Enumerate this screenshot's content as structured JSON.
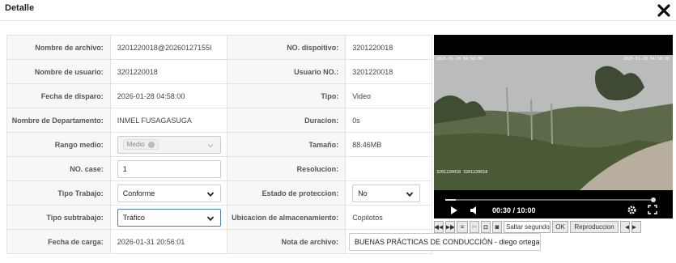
{
  "dialog": {
    "title": "Detalle"
  },
  "fields": {
    "file_name": {
      "label": "Nombre de archivo:",
      "value": "3201220018@20260127155I"
    },
    "device_no": {
      "label": "NO. dispoitivo:",
      "value": "3201220018"
    },
    "user_name": {
      "label": "Nombre de usuario:",
      "value": "3201220018"
    },
    "user_no": {
      "label": "Usuario NO.:",
      "value": "3201220018"
    },
    "trigger_date": {
      "label": "Fecha de disparo:",
      "value": "2026-01-28 04:58:00"
    },
    "type": {
      "label": "Tipo:",
      "value": "Video"
    },
    "department": {
      "label": "Nombre de Departamento:",
      "value": "INMEL FUSAGASUGA"
    },
    "duration": {
      "label": "Duracion:",
      "value": "0s"
    },
    "range": {
      "label": "Rango medio:",
      "value": "Medio"
    },
    "size": {
      "label": "Tamaño:",
      "value": "88.46MB"
    },
    "case_no": {
      "label": "NO. case:",
      "value": "1"
    },
    "resolution": {
      "label": "Resolucion:",
      "value": ""
    },
    "work_type": {
      "label": "Tipo Trabajo:",
      "value": "Conforme"
    },
    "protection": {
      "label": "Estado de proteccion:",
      "value": "No"
    },
    "work_subtype": {
      "label": "Tipo subtrabajo:",
      "value": "Tráfico"
    },
    "storage": {
      "label": "Ubicacion de almacenamiento:",
      "value": "Copilotos"
    },
    "upload_date": {
      "label": "Fecha de carga:",
      "value": "2026-01-31 20:56:01"
    },
    "file_note": {
      "label": "Nota de archivo:",
      "value": "BUENAS PRÁCTICAS DE CONDUCCIÓN - diego ortega"
    }
  },
  "video": {
    "time": "00:30 / 10:00",
    "progress": 0.05,
    "osd_top_left": "2026-01-28 04:58:00",
    "osd_top_right": "2026-01-28 04:58:00",
    "osd_bottom": "3201220018 3201220018"
  },
  "toolbar": {
    "skip_placeholder": "Saltar segundos",
    "ok_label": "OK",
    "play_label": "Reproduccion"
  },
  "colors": {
    "accent": "#4a7cc9",
    "label_bg": "#f7f7f7",
    "border": "#e3e3e3"
  }
}
